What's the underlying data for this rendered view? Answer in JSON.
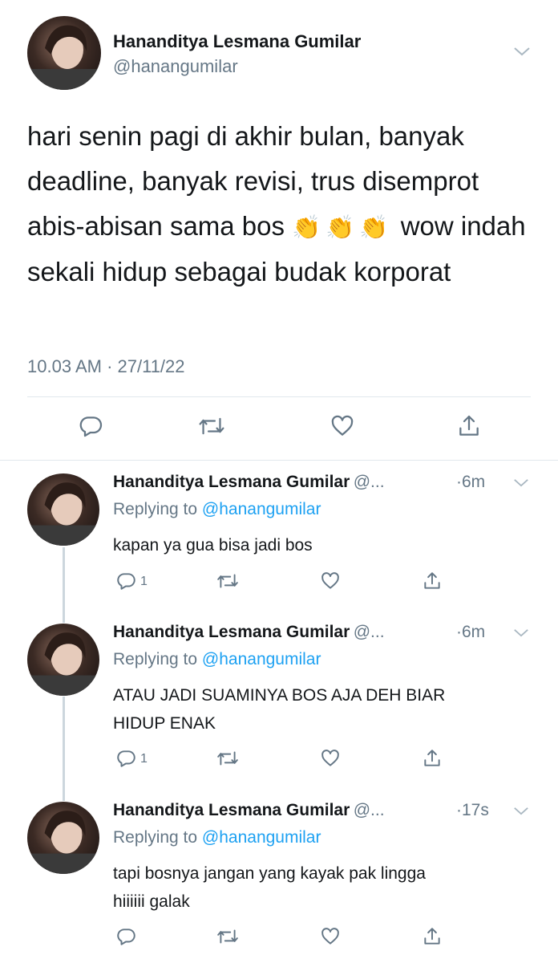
{
  "main_tweet": {
    "display_name": "Hananditya Lesmana Gumilar",
    "handle": "@hanangumilar",
    "text_before": "hari senin pagi di akhir bulan, banyak deadline, banyak revisi, trus disemprot abis-abisan sama bos",
    "emoji": "👏👏👏",
    "text_after": "wow indah sekali hidup sebagai budak korporat",
    "timestamp": "10.03 AM · 27/11/22"
  },
  "replies": [
    {
      "display_name": "Hananditya Lesmana Gumilar",
      "handle": "@...",
      "time": "·6m",
      "replying_prefix": "Replying to",
      "replying_to": "@hanangumilar",
      "text_lines": [
        "kapan ya gua bisa jadi bos"
      ],
      "reply_count": "1"
    },
    {
      "display_name": "Hananditya Lesmana Gumilar",
      "handle": "@...",
      "time": "·6m",
      "replying_prefix": "Replying to",
      "replying_to": "@hanangumilar",
      "text_lines": [
        "ATAU JADI SUAMINYA BOS AJA DEH BIAR",
        "HIDUP ENAK"
      ],
      "reply_count": "1"
    },
    {
      "display_name": "Hananditya Lesmana Gumilar",
      "handle": "@...",
      "time": "·17s",
      "replying_prefix": "Replying to",
      "replying_to": "@hanangumilar",
      "text_lines": [
        "tapi bosnya jangan yang kayak pak lingga",
        "hiiiiii galak"
      ],
      "reply_count": ""
    }
  ],
  "icons": {
    "reply": "reply-icon",
    "retweet": "retweet-icon",
    "like": "like-icon",
    "share": "share-icon",
    "more": "chevron-down-icon"
  },
  "colors": {
    "text": "#14171a",
    "secondary": "#657786",
    "link": "#1da1f2",
    "divider": "#e1e8ed",
    "thread_line": "#ccd6dd"
  }
}
